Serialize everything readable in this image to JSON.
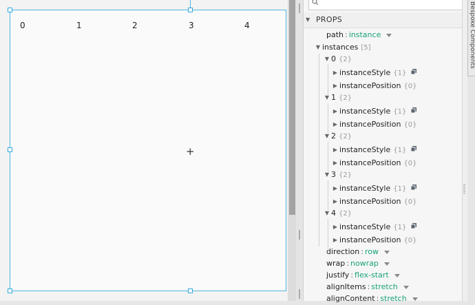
{
  "canvas": {
    "column_labels": [
      "0",
      "1",
      "2",
      "3",
      "4"
    ],
    "crosshair_symbol": "+"
  },
  "inspector": {
    "search": {
      "placeholder": ""
    },
    "section_title": "PROPS",
    "path": {
      "name": "path",
      "value": "instance"
    },
    "instances": {
      "name": "instances",
      "count": "[5]",
      "items": [
        {
          "index": "0",
          "count": "{2}"
        },
        {
          "index": "1",
          "count": "{2}"
        },
        {
          "index": "2",
          "count": "{2}"
        },
        {
          "index": "3",
          "count": "{2}"
        },
        {
          "index": "4",
          "count": "{2}"
        }
      ],
      "child_style": {
        "name": "instanceStyle",
        "count": "{1}"
      },
      "child_position": {
        "name": "instancePosition",
        "count": "{0}"
      }
    },
    "direction": {
      "name": "direction",
      "value": "row"
    },
    "wrap": {
      "name": "wrap",
      "value": "nowrap"
    },
    "justify": {
      "name": "justify",
      "value": "flex-start"
    },
    "alignItems": {
      "name": "alignItems",
      "value": "stretch"
    },
    "alignContent": {
      "name": "alignContent",
      "value": "stretch"
    }
  },
  "side_tab": {
    "label": "Bespoke Components"
  },
  "colors": {
    "selection": "#4fb6e0",
    "value_text": "#1aa37a"
  }
}
